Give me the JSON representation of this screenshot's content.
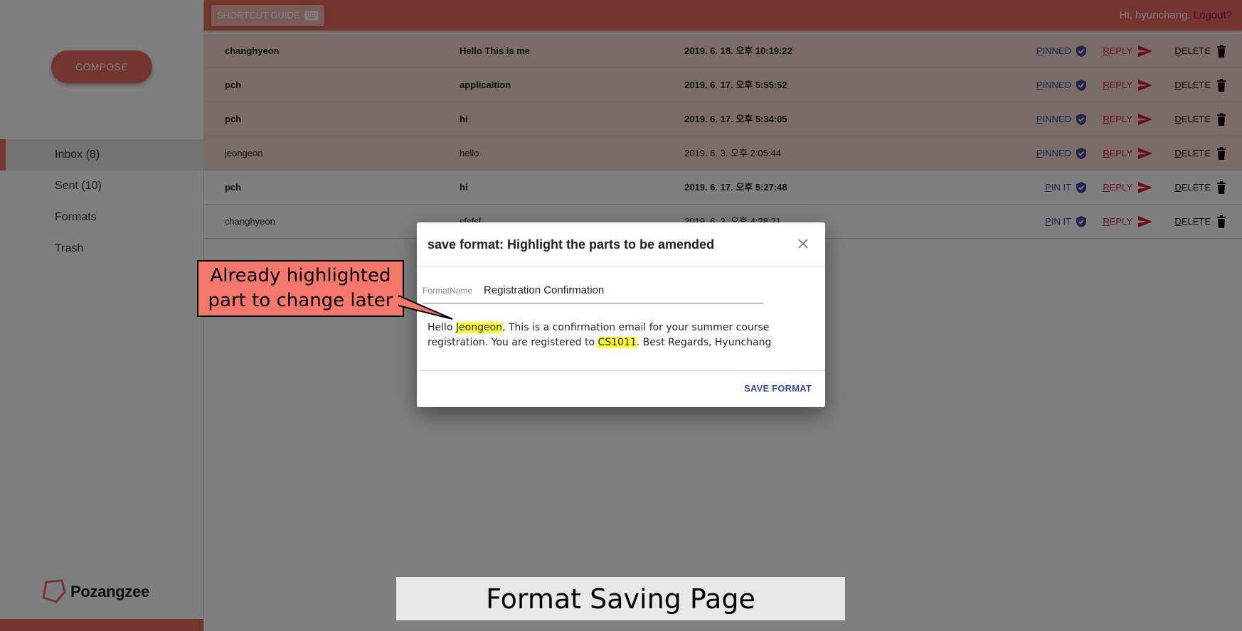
{
  "sidebar": {
    "compose_label": "COMPOSE",
    "nav": [
      {
        "label": "Inbox (8)",
        "active": true
      },
      {
        "label": "Sent (10)",
        "active": false
      },
      {
        "label": "Formats",
        "active": false
      },
      {
        "label": "Trash",
        "active": false
      }
    ],
    "logo_text": "Pozangzee"
  },
  "topbar": {
    "shortcut_label": "SHORTCUT GUIDE",
    "greeting": "Hi, hyunchang.",
    "logout_label": "Logout?"
  },
  "mails": [
    {
      "from": "changhyeon",
      "subject": "Hello This is me",
      "date": "2019. 6. 18. 오후 10:19:22",
      "pin_label": "PINNED",
      "reply_label": "REPLY",
      "delete_label": "DELETE",
      "pinned": true,
      "unread": true
    },
    {
      "from": "pch",
      "subject": "applicaition",
      "date": "2019. 6. 17. 오후 5:55:52",
      "pin_label": "PINNED",
      "reply_label": "REPLY",
      "delete_label": "DELETE",
      "pinned": true,
      "unread": true
    },
    {
      "from": "pch",
      "subject": "hi",
      "date": "2019. 6. 17. 오후 5:34:05",
      "pin_label": "PINNED",
      "reply_label": "REPLY",
      "delete_label": "DELETE",
      "pinned": true,
      "unread": true
    },
    {
      "from": "jeongeon",
      "subject": "hello",
      "date": "2019. 6. 3. 오후 2:05:44",
      "pin_label": "PINNED",
      "reply_label": "REPLY",
      "delete_label": "DELETE",
      "pinned": true,
      "unread": false
    },
    {
      "from": "pch",
      "subject": "hi",
      "date": "2019. 6. 17. 오후 5:27:48",
      "pin_label": "PIN IT",
      "reply_label": "REPLY",
      "delete_label": "DELETE",
      "pinned": false,
      "unread": true
    },
    {
      "from": "changhyeon",
      "subject": "sfsfsf",
      "date": "2019. 6. 3. 오후 4:28:21",
      "pin_label": "PIN IT",
      "reply_label": "REPLY",
      "delete_label": "DELETE",
      "pinned": false,
      "unread": false
    }
  ],
  "dialog": {
    "title": "save format: Highlight the parts to be amended",
    "field_label": "FormatName",
    "field_value": "Registration Confirmation",
    "body": {
      "t1": "Hello ",
      "h1": "Jeongeon",
      "t2": ", This is a confirmation email for your summer course registration. You are registered to ",
      "h2": "CS1011",
      "t3": ". Best Regards, Hyunchang"
    },
    "save_label": "SAVE FORMAT"
  },
  "annotation": {
    "callout": "Already highlighted part to change later",
    "caption": "Format Saving Page"
  },
  "colors": {
    "accent": "#e86a5e",
    "pinned_row": "#f7d7d3",
    "pin": "#3d4a9e",
    "reply": "#d81b3c",
    "highlight": "#ffff33",
    "callout": "#f6776b"
  },
  "icons": [
    "keyboard-icon",
    "verified-pin-icon",
    "send-icon",
    "trash-icon",
    "close-icon",
    "logo-icon"
  ]
}
